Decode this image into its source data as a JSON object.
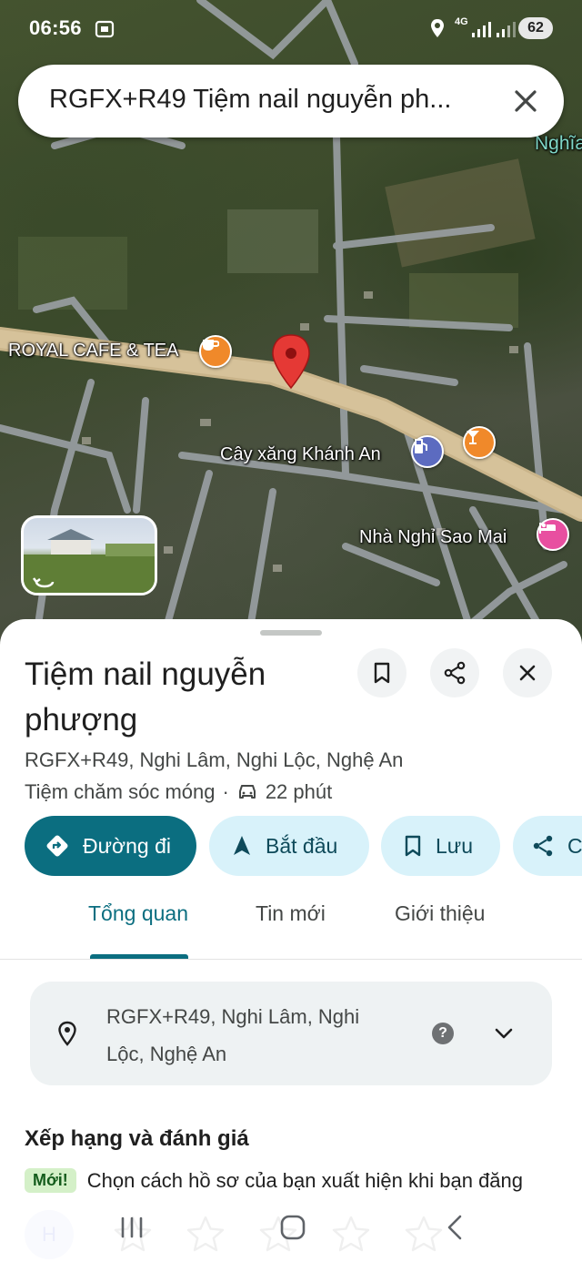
{
  "status_bar": {
    "time": "06:56",
    "network": "4G",
    "battery": "62",
    "icons": [
      "screenshot-icon",
      "location-icon",
      "signal-icon",
      "signal-icon",
      "battery-icon"
    ]
  },
  "search": {
    "query": "RGFX+R49 Tiệm nail nguyễn ph...",
    "clear_icon": "close-icon"
  },
  "map": {
    "labels": {
      "royal_cafe": "ROYAL CAFE & TEA",
      "gas_station": "Cây xăng Khánh An",
      "guesthouse": "Nhà Nghỉ Sao Mai",
      "corner": "Nghĩa"
    },
    "pin_color": "#e53935",
    "poi_colors": {
      "cafe": "#f0892a",
      "bar": "#f0892a",
      "gas": "#5c6bc0",
      "hotel": "#e84fa0"
    }
  },
  "place": {
    "name": "Tiệm nail nguyễn phượng",
    "address": "RGFX+R49, Nghi Lâm, Nghi Lộc, Nghệ An",
    "category": "Tiệm chăm sóc móng",
    "separator": "·",
    "drive_time": "22 phút"
  },
  "actions": {
    "directions": "Đường đi",
    "start": "Bắt đầu",
    "save": "Lưu",
    "share": "C"
  },
  "tabs": {
    "overview": "Tổng quan",
    "updates": "Tin mới",
    "about": "Giới thiệu"
  },
  "address_card": {
    "text": "RGFX+R49, Nghi Lâm, Nghi Lộc, Nghệ An"
  },
  "ratings": {
    "heading": "Xếp hạng và đánh giá",
    "new_badge": "Mới!",
    "new_text": "Chọn cách hồ sơ của bạn xuất hiện khi bạn đăng",
    "avatar_letter": "H",
    "star_count": 5
  },
  "accent_color": "#0b6e80"
}
